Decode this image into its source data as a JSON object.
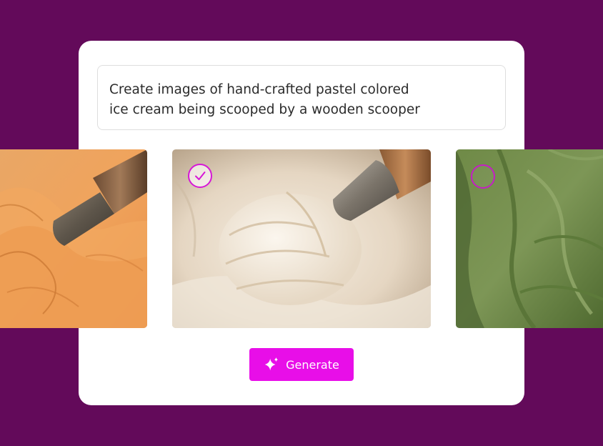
{
  "prompt": {
    "line1": "Create images of hand-crafted pastel colored",
    "line2": "ice cream being scooped by a wooden scooper"
  },
  "images": [
    {
      "subject": "orange ice cream scoop",
      "selected": false
    },
    {
      "subject": "vanilla ice cream scoop",
      "selected": true
    },
    {
      "subject": "green ice cream texture",
      "selected": false
    }
  ],
  "generate_button": {
    "label": "Generate",
    "icon": "sparkle-icon"
  },
  "colors": {
    "background": "#630a5a",
    "accent": "#e80ee8",
    "card": "#ffffff"
  }
}
